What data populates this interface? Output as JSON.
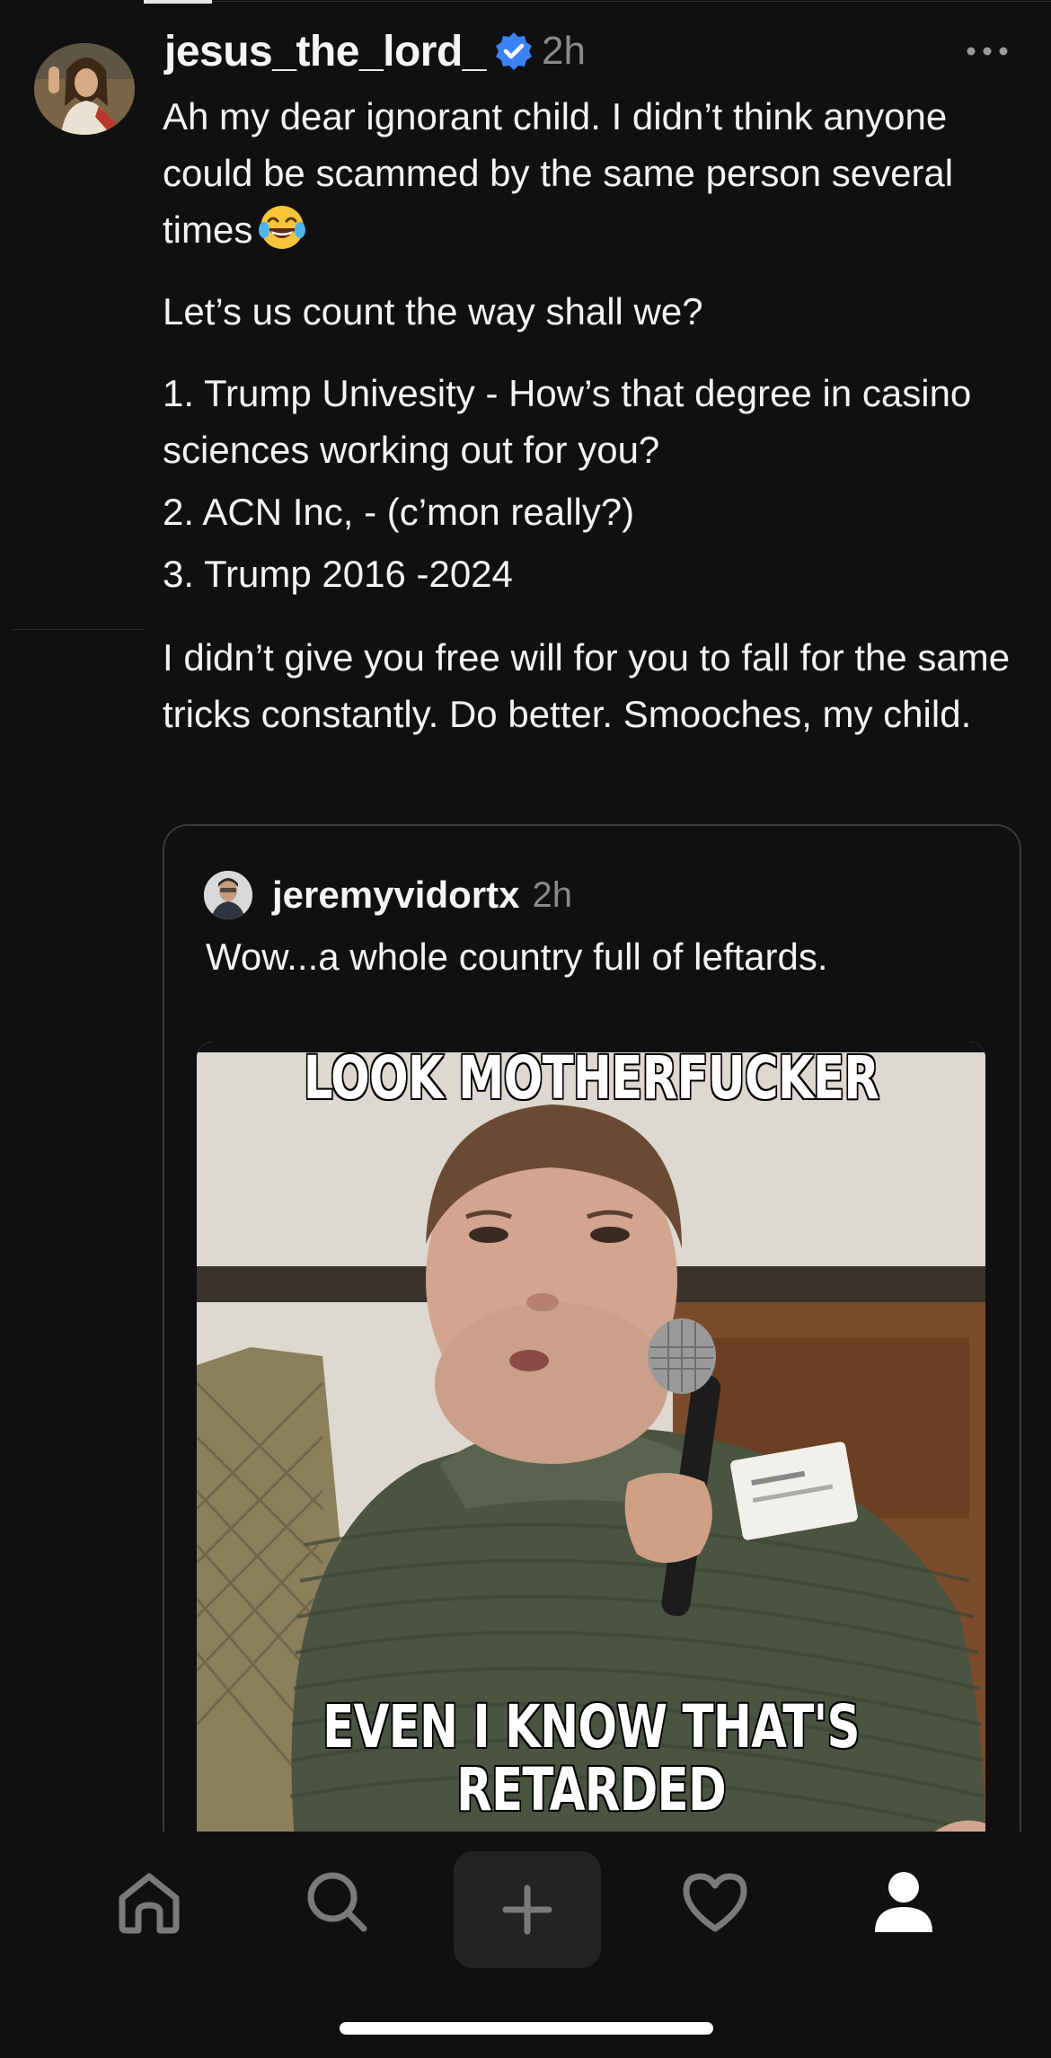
{
  "post": {
    "username": "jesus_the_lord_",
    "time": "2h",
    "paragraph1": "Ah my dear ignorant child. I didn’t think anyone could be scammed by the same person several times",
    "paragraph2": "Let’s us count the way shall we?",
    "list": [
      "1. Trump Univesity - How’s that degree in casino sciences working out for you?",
      "2. ACN Inc, - (c’mon really?)",
      "3. Trump 2016 -2024"
    ],
    "paragraph3": "I didn’t give you free will for you to fall for the same tricks constantly. Do better.  Smooches, my child."
  },
  "quote": {
    "username": "jeremyvidortx",
    "time": "2h",
    "text": "Wow...a whole country full of leftards.",
    "meme_top": "LOOK MOTHERFUCKER",
    "meme_bottom_line1": "EVEN I KNOW THAT'S",
    "meme_bottom_line2": "RETARDED"
  },
  "nav": {
    "items": [
      "home-icon",
      "search-icon",
      "create-icon",
      "activity-heart-icon",
      "profile-icon"
    ]
  },
  "colors": {
    "background": "#101010",
    "verified": "#3b82f6",
    "muted": "#8a8a8a"
  }
}
